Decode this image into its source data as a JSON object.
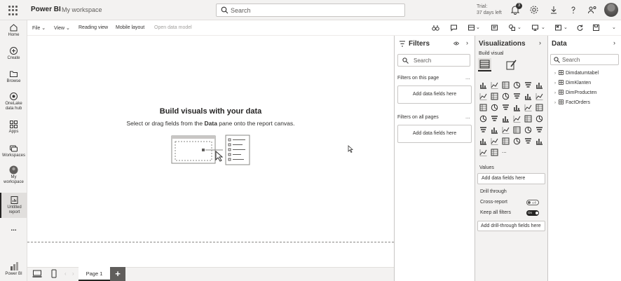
{
  "topbar": {
    "app_name": "Power BI",
    "workspace": "My workspace",
    "search_placeholder": "Search",
    "trial_line1": "Trial:",
    "trial_line2": "37 days left",
    "notification_count": "3"
  },
  "leftnav": {
    "items": [
      {
        "label": "Home",
        "icon": "home-icon"
      },
      {
        "label": "Create",
        "icon": "plus-circle-icon"
      },
      {
        "label": "Browse",
        "icon": "folder-icon"
      },
      {
        "label": "OneLake data hub",
        "icon": "onelake-icon"
      },
      {
        "label": "Apps",
        "icon": "apps-icon"
      },
      {
        "label": "Workspaces",
        "icon": "workspaces-icon"
      },
      {
        "label": "My workspace",
        "icon": "avatar-icon"
      },
      {
        "label": "Untitled report",
        "icon": "report-icon"
      }
    ],
    "more": "...",
    "footer": "Power BI"
  },
  "ribbon": {
    "file": "File",
    "view": "View",
    "reading_view": "Reading view",
    "mobile_layout": "Mobile layout",
    "open_data_model": "Open data model"
  },
  "canvas": {
    "title": "Build visuals with your data",
    "subtitle_pre": "Select or drag fields from the ",
    "subtitle_bold": "Data",
    "subtitle_post": " pane onto the report canvas."
  },
  "pages": {
    "tab": "Page 1",
    "add": "+"
  },
  "filters": {
    "title": "Filters",
    "search_placeholder": "Search",
    "on_this_page": "Filters on this page",
    "on_all_pages": "Filters on all pages",
    "add_fields": "Add data fields here",
    "ellipsis": "..."
  },
  "visualizations": {
    "title": "Visualizations",
    "build_visual": "Build visual",
    "values": "Values",
    "add_fields": "Add data fields here",
    "drill_through": "Drill through",
    "cross_report": "Cross-report",
    "cross_report_state": "Off",
    "keep_all_filters": "Keep all filters",
    "keep_all_filters_state": "On",
    "add_drill_fields": "Add drill-through fields here",
    "more_visuals": "..."
  },
  "data": {
    "title": "Data",
    "search_placeholder": "Search",
    "tables": [
      "Dimdatumtabel",
      "DimKlanten",
      "DimProducten",
      "FactOrders"
    ]
  },
  "colors": {
    "canvas": "#ffffff",
    "chrome": "#f3f2f1",
    "text": "#323130",
    "accent": "#252423"
  }
}
